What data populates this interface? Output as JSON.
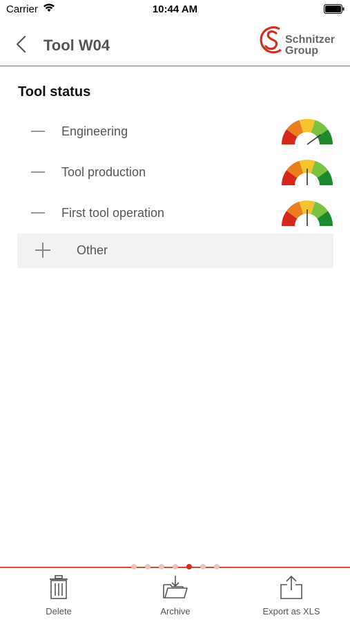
{
  "status_bar": {
    "carrier": "Carrier",
    "time": "10:44 AM"
  },
  "nav": {
    "title": "Tool W04"
  },
  "logo": {
    "line1": "Schnitzer",
    "line2": "Group",
    "brand_color": "#d42e22"
  },
  "section": {
    "title": "Tool status"
  },
  "statuses": [
    {
      "label": "Engineering",
      "gauge_level": 0.8
    },
    {
      "label": "Tool production",
      "gauge_level": 0.5
    },
    {
      "label": "First tool operation",
      "gauge_level": 0.5
    }
  ],
  "other": {
    "label": "Other"
  },
  "pager": {
    "count": 7,
    "active_index": 4
  },
  "toolbar": {
    "delete_label": "Delete",
    "archive_label": "Archive",
    "export_label": "Export as XLS"
  },
  "colors": {
    "accent": "#d44a3c",
    "gauge": [
      "#d7261e",
      "#e97f1e",
      "#f4c430",
      "#7cc242",
      "#1e8a2e"
    ]
  }
}
